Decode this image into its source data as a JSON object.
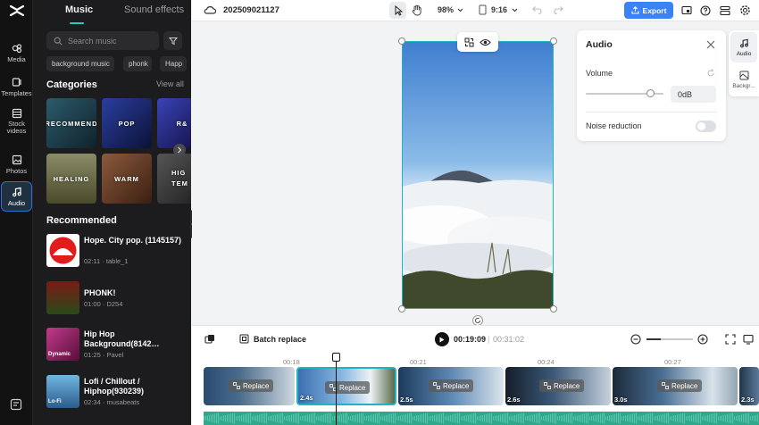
{
  "rail": {
    "items": [
      {
        "label": "Media",
        "icon": "media-icon"
      },
      {
        "label": "Templates",
        "icon": "templates-icon"
      },
      {
        "label": "Stock videos",
        "icon": "stock-videos-icon"
      },
      {
        "label": "Photos",
        "icon": "photos-icon"
      },
      {
        "label": "Audio",
        "icon": "audio-icon",
        "active": true
      }
    ]
  },
  "panel": {
    "tabs": [
      "Music",
      "Sound effects"
    ],
    "search_placeholder": "Search music",
    "chips": [
      "background music",
      "phonk",
      "Happ"
    ],
    "categories_title": "Categories",
    "view_all": "View all",
    "categories": [
      {
        "label": "RECOMMEND",
        "color": "#1c3a4a"
      },
      {
        "label": "POP",
        "color": "#1a2a6c"
      },
      {
        "label": "R&",
        "color": "#222a7a"
      },
      {
        "label": "HEALING",
        "color": "#6b6a4a"
      },
      {
        "label": "WARM",
        "color": "#6a3f2b"
      },
      {
        "label": "HIG TEM",
        "color": "#3a3a3a"
      }
    ],
    "recommended_title": "Recommended",
    "tracks": [
      {
        "title": "Hope. City pop. (1145157)",
        "duration": "02:11",
        "author": "table_1"
      },
      {
        "title": "PHONK!",
        "duration": "01:00",
        "author": "D254"
      },
      {
        "title": "Hip Hop Background(8142…",
        "duration": "01:25",
        "author": "Pavel",
        "thumb_text": "Dynamic"
      },
      {
        "title": "Lofi / Chillout / Hiphop(930239)",
        "duration": "02:34",
        "author": "musabeats",
        "thumb_text": "Lo-Fi"
      }
    ]
  },
  "topbar": {
    "project_name": "202509021127",
    "zoom": "98%",
    "ratio": "9:16",
    "export_label": "Export"
  },
  "audio_panel": {
    "title": "Audio",
    "volume_label": "Volume",
    "volume_value": "0dB",
    "volume_level": 0.83,
    "noise_label": "Noise reduction",
    "noise_on": false
  },
  "prop_tabs": [
    "Audio",
    "Backgr..."
  ],
  "timeline": {
    "batch_replace": "Batch replace",
    "current_time": "00:19:09",
    "total_time": "00:31:02",
    "ruler": [
      "00:18",
      "00:21",
      "00:24",
      "00:27"
    ],
    "replace_label": "Replace",
    "clips": [
      {
        "duration": "",
        "selected": false
      },
      {
        "duration": "2.4s",
        "selected": true
      },
      {
        "duration": "2.5s",
        "selected": false
      },
      {
        "duration": "2.6s",
        "selected": false
      },
      {
        "duration": "3.0s",
        "selected": false
      },
      {
        "duration": "2.3s",
        "selected": false
      }
    ]
  },
  "colors": {
    "accent": "#1fb3c8",
    "export": "#3b82f6",
    "audio_wave": "#2fa88c"
  }
}
